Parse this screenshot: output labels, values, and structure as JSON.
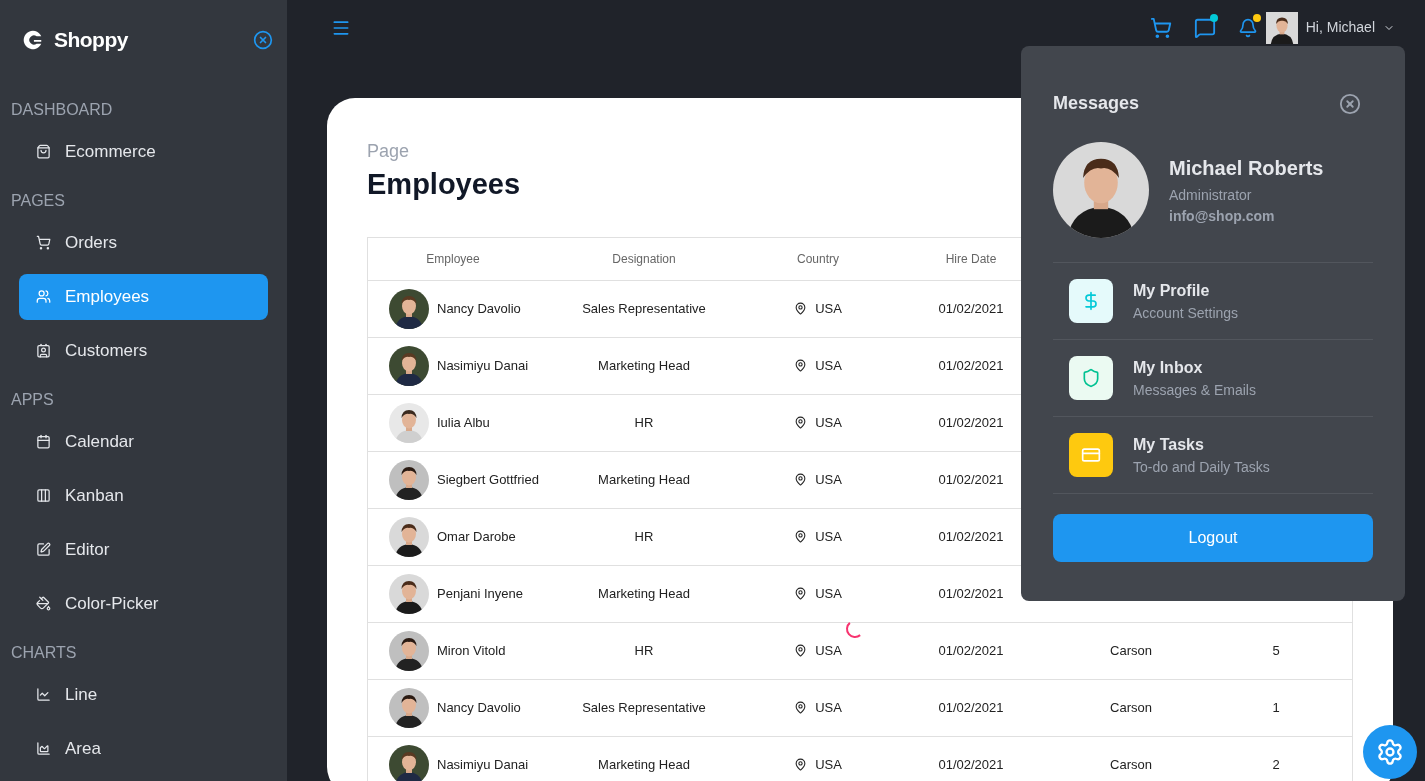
{
  "sidebar": {
    "logo": "Shoppy",
    "sections": [
      {
        "title": "DASHBOARD",
        "items": [
          {
            "label": "Ecommerce",
            "selected": false
          }
        ]
      },
      {
        "title": "PAGES",
        "items": [
          {
            "label": "Orders",
            "selected": false
          },
          {
            "label": "Employees",
            "selected": true
          },
          {
            "label": "Customers",
            "selected": false
          }
        ]
      },
      {
        "title": "APPS",
        "items": [
          {
            "label": "Calendar",
            "selected": false
          },
          {
            "label": "Kanban",
            "selected": false
          },
          {
            "label": "Editor",
            "selected": false
          },
          {
            "label": "Color-Picker",
            "selected": false
          }
        ]
      },
      {
        "title": "CHARTS",
        "items": [
          {
            "label": "Line",
            "selected": false
          },
          {
            "label": "Area",
            "selected": false
          }
        ]
      }
    ]
  },
  "topbar": {
    "greeting": "Hi,",
    "user": "Michael",
    "chat_unread": true,
    "notifications_unread": true
  },
  "page": {
    "subtitle": "Page",
    "title": "Employees"
  },
  "table": {
    "columns": [
      "Employee",
      "Designation",
      "Country",
      "Hire Date"
    ],
    "rows": [
      {
        "employee": "Nancy Davolio",
        "designation": "Sales Representative",
        "country": "USA",
        "hire_date": "01/02/2021"
      },
      {
        "employee": "Nasimiyu Danai",
        "designation": "Marketing Head",
        "country": "USA",
        "hire_date": "01/02/2021"
      },
      {
        "employee": "Iulia Albu",
        "designation": "HR",
        "country": "USA",
        "hire_date": "01/02/2021"
      },
      {
        "employee": "Siegbert Gottfried",
        "designation": "Marketing Head",
        "country": "USA",
        "hire_date": "01/02/2021"
      },
      {
        "employee": "Omar Darobe",
        "designation": "HR",
        "country": "USA",
        "hire_date": "01/02/2021"
      },
      {
        "employee": "Penjani Inyene",
        "designation": "Marketing Head",
        "country": "USA",
        "hire_date": "01/02/2021"
      },
      {
        "employee": "Miron Vitold",
        "designation": "HR",
        "country": "USA",
        "hire_date": "01/02/2021",
        "column_5": "Carson",
        "column_6": "5"
      },
      {
        "employee": "Nancy Davolio",
        "designation": "Sales Representative",
        "country": "USA",
        "hire_date": "01/02/2021",
        "column_5": "Carson",
        "column_6": "1"
      },
      {
        "employee": "Nasimiyu Danai",
        "designation": "Marketing Head",
        "country": "USA",
        "hire_date": "01/02/2021",
        "column_5": "Carson",
        "column_6": "2"
      }
    ]
  },
  "profile_popup": {
    "title": "Messages",
    "name": "Michael Roberts",
    "role": "Administrator",
    "email": "info@shop.com",
    "items": [
      {
        "title": "My Profile",
        "description": "Account Settings",
        "color": "#e5fafb"
      },
      {
        "title": "My Inbox",
        "description": "Messages & Emails",
        "color": "#ebfaf2"
      },
      {
        "title": "My Tasks",
        "description": "To-do and Daily Tasks",
        "color": "#fec90f"
      }
    ],
    "logout": "Logout"
  }
}
